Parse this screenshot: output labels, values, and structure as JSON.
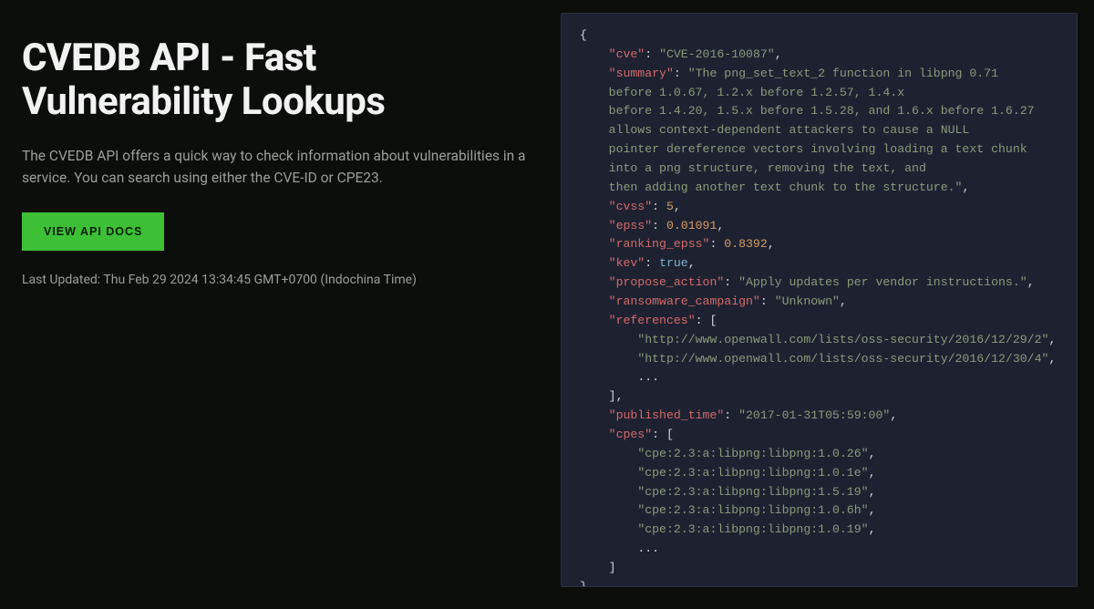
{
  "hero": {
    "title_lead": "CVEDB API - Fast",
    "title_rest": "Vulnerability Lookups",
    "description": "The CVEDB API offers a quick way to check information about vulnerabilities in a service. You can search using either the CVE-ID or CPE23.",
    "button_label": "VIEW API DOCS",
    "last_updated": "Last Updated: Thu Feb 29 2024 13:34:45 GMT+0700 (Indochina Time)"
  },
  "code": {
    "cve": "CVE-2016-10087",
    "summary_lines": [
      "The png_set_text_2 function in libpng 0.71",
      "before 1.0.67, 1.2.x before 1.2.57, 1.4.x",
      "before 1.4.20, 1.5.x before 1.5.28, and 1.6.x before 1.6.27",
      "allows context-dependent attackers to cause a NULL",
      "pointer dereference vectors involving loading a text chunk",
      "into a png structure, removing the text, and",
      "then adding another text chunk to the structure."
    ],
    "cvss": 5,
    "epss": 0.01091,
    "ranking_epss": 0.8392,
    "kev": true,
    "propose_action": "Apply updates per vendor instructions.",
    "ransomware_campaign": "Unknown",
    "references": [
      "http://www.openwall.com/lists/oss-security/2016/12/29/2",
      "http://www.openwall.com/lists/oss-security/2016/12/30/4"
    ],
    "published_time": "2017-01-31T05:59:00",
    "cpes": [
      "cpe:2.3:a:libpng:libpng:1.0.26",
      "cpe:2.3:a:libpng:libpng:1.0.1e",
      "cpe:2.3:a:libpng:libpng:1.5.19",
      "cpe:2.3:a:libpng:libpng:1.0.6h",
      "cpe:2.3:a:libpng:libpng:1.0.19"
    ]
  }
}
